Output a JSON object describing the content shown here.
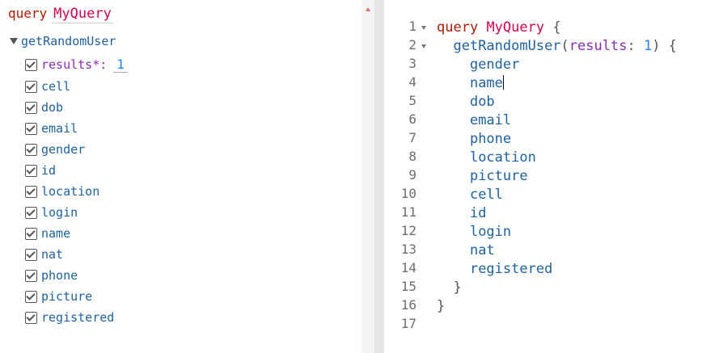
{
  "explorer": {
    "keyword": "query",
    "query_name": "MyQuery",
    "root_field": "getRandomUser",
    "argument": {
      "name": "results*:",
      "value": "1"
    },
    "fields": [
      "cell",
      "dob",
      "email",
      "gender",
      "id",
      "location",
      "login",
      "name",
      "nat",
      "phone",
      "picture",
      "registered"
    ]
  },
  "editor": {
    "line_numbers": [
      "1",
      "2",
      "3",
      "4",
      "5",
      "6",
      "7",
      "8",
      "9",
      "10",
      "11",
      "12",
      "13",
      "14",
      "15",
      "16",
      "17"
    ],
    "line1": {
      "kw": "query",
      "name": "MyQuery",
      "brace": "{"
    },
    "line2": {
      "field": "getRandomUser",
      "open": "(",
      "arg": "results",
      "colon": ": ",
      "num": "1",
      "close": ")",
      "brace": " {"
    },
    "fields": [
      "gender",
      "name",
      "dob",
      "email",
      "phone",
      "location",
      "picture",
      "cell",
      "id",
      "login",
      "nat",
      "registered"
    ],
    "close_inner": "}",
    "close_outer": "}"
  }
}
